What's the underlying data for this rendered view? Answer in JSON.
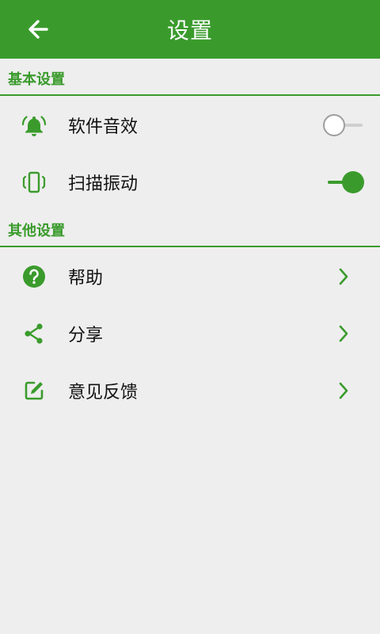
{
  "header": {
    "title": "设置",
    "back_icon": "arrow-left-icon"
  },
  "sections": {
    "basic": {
      "title": "基本设置",
      "items": [
        {
          "label": "软件音效",
          "icon": "bell-alert-icon",
          "toggle": false
        },
        {
          "label": "扫描振动",
          "icon": "vibration-icon",
          "toggle": true
        }
      ]
    },
    "other": {
      "title": "其他设置",
      "items": [
        {
          "label": "帮助",
          "icon": "help-circle-icon"
        },
        {
          "label": "分享",
          "icon": "share-icon"
        },
        {
          "label": "意见反馈",
          "icon": "edit-feedback-icon"
        }
      ]
    }
  },
  "colors": {
    "brand_green": "#3a9b2c",
    "background": "#eeeeee",
    "text": "#111111"
  }
}
